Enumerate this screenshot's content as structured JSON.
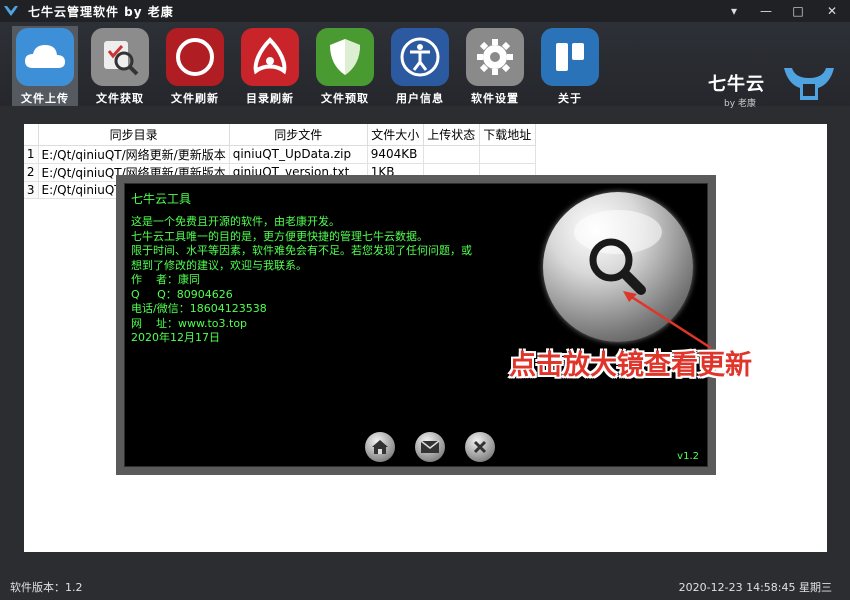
{
  "window": {
    "title": "七牛云管理软件 by 老康",
    "controls": [
      "▾",
      "—",
      "□",
      "✕"
    ]
  },
  "toolbar": {
    "tools": [
      {
        "label": "文件上传",
        "icon": "cloud-icon",
        "color": "#3d8fd8",
        "active": true
      },
      {
        "label": "文件获取",
        "icon": "checklist-magnifier-icon",
        "color": "#8c8c8c"
      },
      {
        "label": "文件刷新",
        "icon": "record-ring-icon",
        "color": "#b01e23"
      },
      {
        "label": "目录刷新",
        "icon": "adobe-air-icon",
        "color": "#c8242a"
      },
      {
        "label": "文件预取",
        "icon": "shield-icon",
        "color": "#4a9a32"
      },
      {
        "label": "用户信息",
        "icon": "accessibility-person-icon",
        "color": "#2c5aa0"
      },
      {
        "label": "软件设置",
        "icon": "gear-icon",
        "color": "#8a8a8a"
      },
      {
        "label": "关于",
        "icon": "trello-board-icon",
        "color": "#2a73b8"
      }
    ]
  },
  "brand": {
    "name": "七牛云",
    "by": "by 老康",
    "logo_color": "#4fa3e0"
  },
  "table": {
    "headers": [
      "同步目录",
      "同步文件",
      "文件大小",
      "上传状态",
      "下载地址"
    ],
    "rows": [
      {
        "num": "1",
        "dir": "E:/Qt/qiniuQT/网络更新/更新版本",
        "file": "qiniuQT_UpData.zip",
        "size": "9404KB",
        "status": "",
        "url": ""
      },
      {
        "num": "2",
        "dir": "E:/Qt/qiniuQT/网络更新/更新版本",
        "file": "qiniuQT_version.txt",
        "size": "1KB",
        "status": "",
        "url": ""
      },
      {
        "num": "3",
        "dir": "E:/Qt/qiniuQT",
        "file": "",
        "size": "",
        "status": "",
        "url": ""
      }
    ]
  },
  "dialog": {
    "title": "七牛云工具",
    "lines": [
      "这是一个免费且开源的软件，由老康开发。",
      "七牛云工具唯一的目的是，更方便更快捷的管理七牛云数据。",
      "限于时间、水平等因素，软件难免会有不足。若您发现了任何问题，或",
      "想到了修改的建议，欢迎与我联系。",
      "作    者：康同",
      "Q     Q：80904626",
      "电话/微信：18604123538",
      "网    址：www.to3.top",
      "",
      "2020年12月17日"
    ],
    "version": "v1.2",
    "callout": "点击放大镜查看更新",
    "buttons": [
      "home-icon",
      "mail-icon",
      "close-icon"
    ],
    "text_color": "#50ff50",
    "callout_color": "#e0352b"
  },
  "status": {
    "left": "软件版本：1.2",
    "right": "2020-12-23 14:58:45 星期三"
  }
}
